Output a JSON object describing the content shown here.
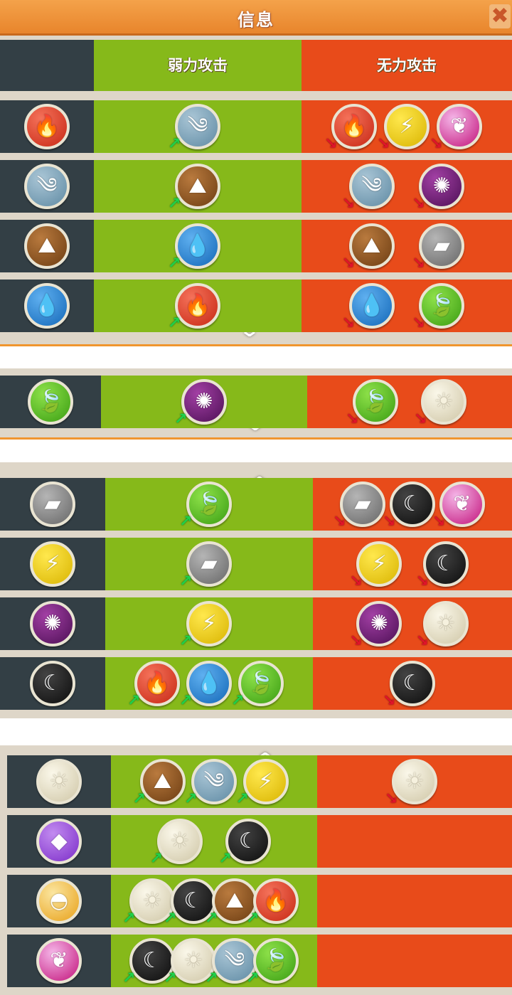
{
  "title": "信息",
  "close_label": "✖",
  "headers": {
    "effective": "弱力攻击",
    "resisted": "无力攻击"
  },
  "icons": {
    "fire": {
      "name": "fire-icon",
      "glyph": "🔥"
    },
    "wind": {
      "name": "wind-icon",
      "glyph": "༄"
    },
    "earth": {
      "name": "earth-icon",
      "glyph": "⛰"
    },
    "water": {
      "name": "water-icon",
      "glyph": "💧"
    },
    "plant": {
      "name": "plant-icon",
      "glyph": "🍃"
    },
    "metal": {
      "name": "metal-icon",
      "glyph": "▰"
    },
    "electric": {
      "name": "electric-icon",
      "glyph": "⚡"
    },
    "dark": {
      "name": "dark-icon",
      "glyph": "✺"
    },
    "moon": {
      "name": "moon-icon",
      "glyph": "☾"
    },
    "light": {
      "name": "light-icon",
      "glyph": "☀"
    },
    "crystal": {
      "name": "crystal-icon",
      "glyph": "◆"
    },
    "legend": {
      "name": "legend-icon",
      "glyph": "◓"
    },
    "special": {
      "name": "special-icon",
      "glyph": "❦"
    }
  },
  "colors": {
    "dark_col": "#333f45",
    "green_col": "#86b91a",
    "red_col": "#e84b1a",
    "title_bar": "#ee9238"
  },
  "sections": [
    {
      "rows": [
        {
          "type": "fire",
          "strong": [
            "wind"
          ],
          "weak": [
            "fire",
            "electric",
            "special"
          ]
        },
        {
          "type": "wind",
          "strong": [
            "earth"
          ],
          "weak": [
            "wind",
            "dark"
          ]
        },
        {
          "type": "earth",
          "strong": [
            "water"
          ],
          "weak": [
            "earth",
            "metal"
          ]
        },
        {
          "type": "water",
          "strong": [
            "fire"
          ],
          "weak": [
            "water",
            "plant"
          ]
        }
      ]
    },
    {
      "rows": [
        {
          "type": "plant",
          "strong": [
            "dark"
          ],
          "weak": [
            "plant",
            "light"
          ]
        }
      ]
    },
    {
      "rows": [
        {
          "type": "metal",
          "strong": [
            "plant"
          ],
          "weak": [
            "metal",
            "moon",
            "special"
          ]
        },
        {
          "type": "electric",
          "strong": [
            "metal"
          ],
          "weak": [
            "electric",
            "moon"
          ]
        },
        {
          "type": "dark",
          "strong": [
            "electric"
          ],
          "weak": [
            "dark",
            "light"
          ]
        },
        {
          "type": "moon",
          "strong": [
            "fire",
            "water",
            "plant"
          ],
          "weak": [
            "moon"
          ]
        }
      ]
    },
    {
      "rows": [
        {
          "type": "light",
          "strong": [
            "earth",
            "wind",
            "electric"
          ],
          "weak": [
            "light"
          ]
        },
        {
          "type": "crystal",
          "strong": [
            "light",
            "moon"
          ],
          "weak": []
        },
        {
          "type": "legend",
          "strong": [
            "light",
            "moon",
            "earth",
            "fire"
          ],
          "weak": []
        },
        {
          "type": "special",
          "strong": [
            "moon",
            "light",
            "wind",
            "plant"
          ],
          "weak": []
        }
      ]
    }
  ]
}
